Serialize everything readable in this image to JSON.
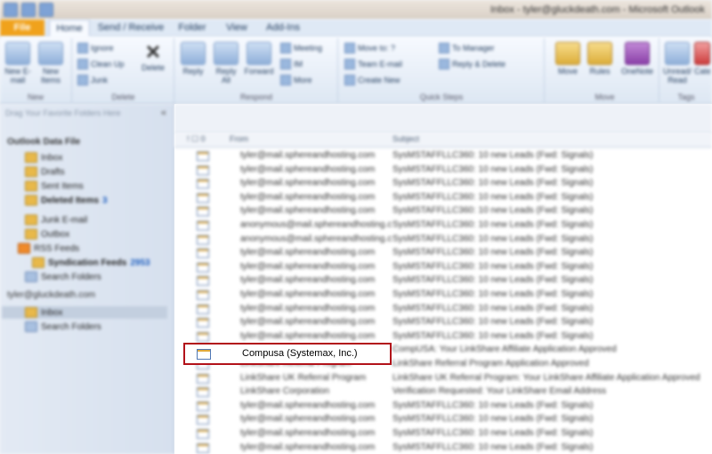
{
  "titlebar": {
    "text": "Inbox - tyler@gluckdeath.com - Microsoft Outlook"
  },
  "tabs": {
    "file": "File",
    "home": "Home",
    "send_receive": "Send / Receive",
    "folder": "Folder",
    "view": "View",
    "addins": "Add-Ins"
  },
  "ribbon": {
    "new_email": "New E-mail",
    "new_items": "New Items",
    "new_group": "New",
    "ignore": "Ignore",
    "clean_up": "Clean Up",
    "junk": "Junk",
    "delete": "Delete",
    "delete_group": "Delete",
    "reply": "Reply",
    "reply_all": "Reply All",
    "forward": "Forward",
    "meeting": "Meeting",
    "im": "IM",
    "more": "More",
    "respond_group": "Respond",
    "move_to": "Move to: ?",
    "team_email": "Team E-mail",
    "create_new": "Create New",
    "to_manager": "To Manager",
    "reply_delete": "Reply & Delete",
    "quick_steps_group": "Quick Steps",
    "move": "Move",
    "rules": "Rules",
    "onenote": "OneNote",
    "move_group": "Move",
    "unread_read": "Unread/ Read",
    "categorize": "Categorize",
    "tags_group": "Tags"
  },
  "nav": {
    "search_placeholder": "Drag Your Favorite Folders Here",
    "close": "«",
    "data_file": "Outlook Data File",
    "folders": [
      "Inbox",
      "Drafts",
      "Sent Items",
      "Deleted Items"
    ],
    "deleted_badge": "3",
    "folders2": [
      "Junk E-mail",
      "Outbox"
    ],
    "rss": "RSS Feeds",
    "rss_sub": "Syndication Feeds",
    "rss_badge": "2953",
    "search_folders": "Search Folders",
    "account": "tyler@gluckdeath.com",
    "account_inbox": "Inbox",
    "account_search": "Search Folders"
  },
  "list": {
    "header_icons": "! ☐ 0",
    "from_header": "From",
    "subject_header": "Subject",
    "rows": [
      {
        "from": "tyler@mail.sphereandhosting.com",
        "subject": "SysMSTAFFLLC360: 10 new Leads (Fwd: Signals)"
      },
      {
        "from": "tyler@mail.sphereandhosting.com",
        "subject": "SysMSTAFFLLC360: 10 new Leads (Fwd: Signals)"
      },
      {
        "from": "tyler@mail.sphereandhosting.com",
        "subject": "SysMSTAFFLLC360: 10 new Leads (Fwd: Signals)"
      },
      {
        "from": "tyler@mail.sphereandhosting.com",
        "subject": "SysMSTAFFLLC360: 10 new Leads (Fwd: Signals)"
      },
      {
        "from": "tyler@mail.sphereandhosting.com",
        "subject": "SysMSTAFFLLC360: 10 new Leads (Fwd: Signals)"
      },
      {
        "from": "anonymous@mail.sphereandhosting.com",
        "subject": "SysMSTAFFLLC360: 10 new Leads (Fwd: Signals)"
      },
      {
        "from": "anonymous@mail.sphereandhosting.com",
        "subject": "SysMSTAFFLLC360: 10 new Leads (Fwd: Signals)"
      },
      {
        "from": "tyler@mail.sphereandhosting.com",
        "subject": "SysMSTAFFLLC360: 10 new Leads (Fwd: Signals)"
      },
      {
        "from": "tyler@mail.sphereandhosting.com",
        "subject": "SysMSTAFFLLC360: 10 new Leads (Fwd: Signals)"
      },
      {
        "from": "tyler@mail.sphereandhosting.com",
        "subject": "SysMSTAFFLLC360: 10 new Leads (Fwd: Signals)"
      },
      {
        "from": "tyler@mail.sphereandhosting.com",
        "subject": "SysMSTAFFLLC360: 10 new Leads (Fwd: Signals)"
      },
      {
        "from": "tyler@mail.sphereandhosting.com",
        "subject": "SysMSTAFFLLC360: 10 new Leads (Fwd: Signals)"
      },
      {
        "from": "tyler@mail.sphereandhosting.com",
        "subject": "SysMSTAFFLLC360: 10 new Leads (Fwd: Signals)"
      },
      {
        "from": "tyler@mail.sphereandhosting.com",
        "subject": "SysMSTAFFLLC360: 10 new Leads (Fwd: Signals)"
      },
      {
        "from": "Compusa (Systemax, Inc.)",
        "subject": "CompUSA: Your LinkShare Affiliate Application Approved"
      },
      {
        "from": "LinkShare Referral Program",
        "subject": "LinkShare Referral Program Application Approved"
      },
      {
        "from": "LinkShare UK Referral Program",
        "subject": "LinkShare UK Referral Program: Your LinkShare Affiliate Application Approved"
      },
      {
        "from": "LinkShare Corporation",
        "subject": "Verification Requested: Your LinkShare Email Address"
      },
      {
        "from": "tyler@mail.sphereandhosting.com",
        "subject": "SysMSTAFFLLC360: 10 new Leads (Fwd: Signals)"
      },
      {
        "from": "tyler@mail.sphereandhosting.com",
        "subject": "SysMSTAFFLLC360: 10 new Leads (Fwd: Signals)"
      },
      {
        "from": "tyler@mail.sphereandhosting.com",
        "subject": "SysMSTAFFLLC360: 10 new Leads (Fwd: Signals)"
      },
      {
        "from": "tyler@mail.sphereandhosting.com",
        "subject": "SysMSTAFFLLC360: 10 new Leads (Fwd: Signals)"
      }
    ],
    "highlighted_from": "Compusa (Systemax, Inc.)"
  },
  "colors": {
    "file_tab": "#f0a21c",
    "highlight_border": "#b2121a"
  }
}
